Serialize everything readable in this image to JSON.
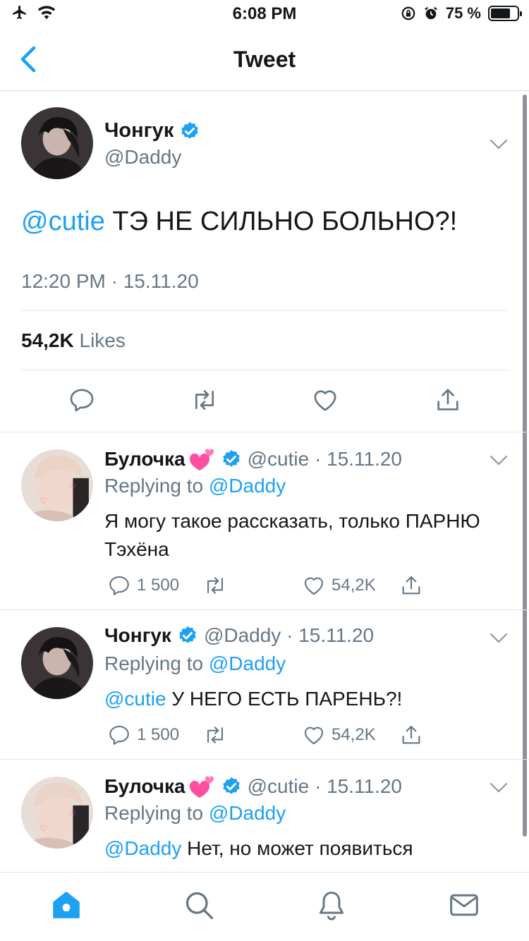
{
  "status_bar": {
    "time": "6:08 PM",
    "battery_percent": "75 %",
    "battery_level": 0.75
  },
  "nav": {
    "title": "Tweet"
  },
  "main_tweet": {
    "name": "Чонгук",
    "handle": "@Daddy",
    "mention": "@cutie",
    "text": " ТЭ НЕ СИЛЬНО БОЛЬНО?!",
    "timestamp": "12:20 PM · 15.11.20",
    "likes_count": "54,2K",
    "likes_label": " Likes"
  },
  "replies": [
    {
      "name": "Булочка",
      "handle_date": "@cutie · 15.11.20",
      "replying_prefix": "Replying to ",
      "replying_to": "@Daddy",
      "mention": "",
      "text": "Я могу такое рассказать, только ПАРНЮ Тэхёна",
      "reply_count": "1 500",
      "like_count": "54,2K"
    },
    {
      "name": "Чонгук",
      "handle_date": "@Daddy · 15.11.20",
      "replying_prefix": "Replying to ",
      "replying_to": "@Daddy",
      "mention": "@cutie",
      "text": " У НЕГО ЕСТЬ ПАРЕНЬ?!",
      "reply_count": "1 500",
      "like_count": "54,2K"
    },
    {
      "name": "Булочка",
      "handle_date": "@cutie · 15.11.20",
      "replying_prefix": "Replying to ",
      "replying_to": "@Daddy",
      "mention": "@Daddy",
      "text": " Нет, но может появиться"
    }
  ],
  "colors": {
    "accent": "#1da1f2",
    "muted": "#657786",
    "text": "#14171a",
    "divider": "#e1e8ed"
  },
  "icons": [
    "airplane-icon",
    "wifi-icon",
    "rotation-lock-icon",
    "alarm-icon",
    "battery-icon",
    "back-chevron-icon",
    "verified-icon",
    "chevron-down-icon",
    "reply-icon",
    "retweet-icon",
    "like-icon",
    "share-icon",
    "home-icon",
    "search-icon",
    "notifications-icon",
    "messages-icon"
  ]
}
